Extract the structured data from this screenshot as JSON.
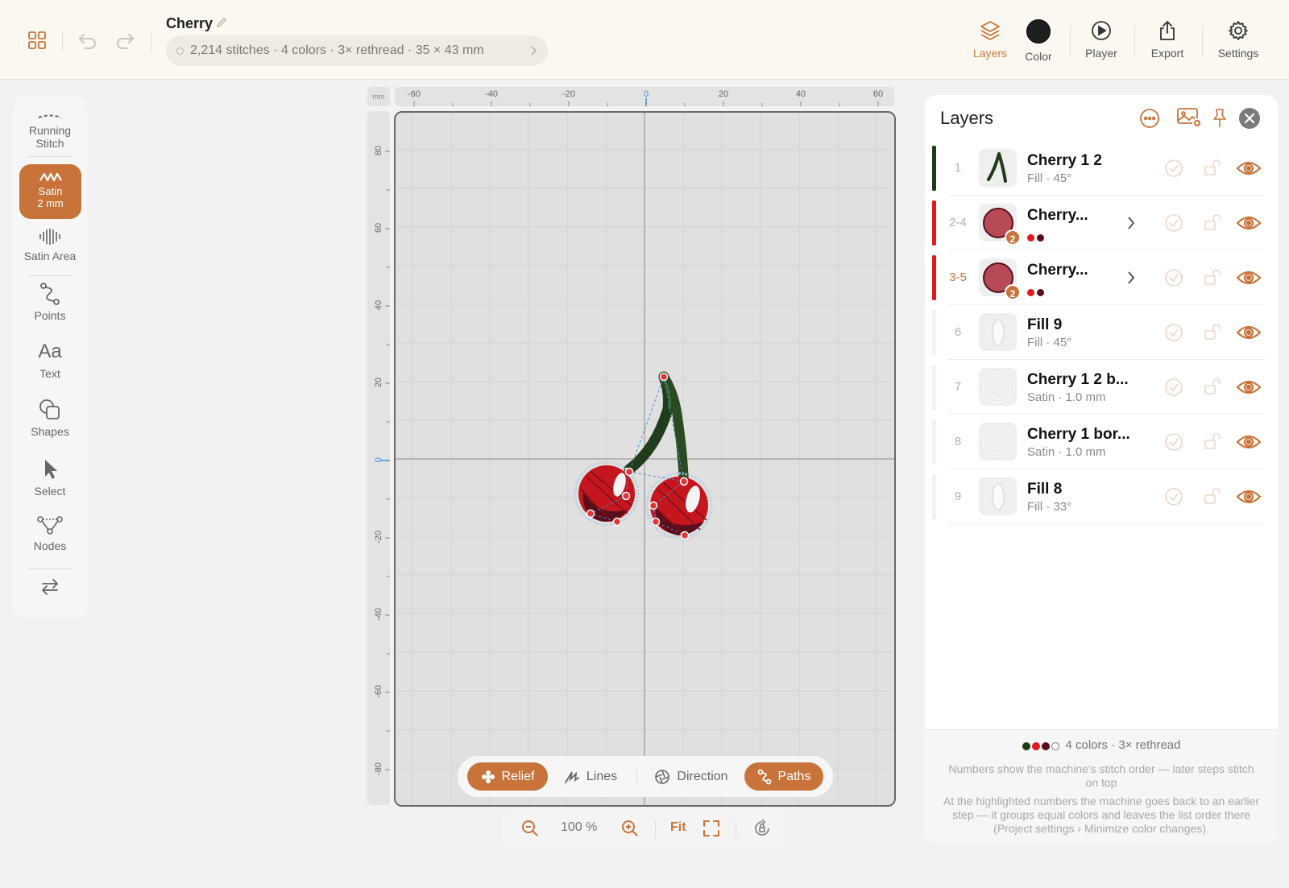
{
  "header": {
    "doc_title": "Cherry",
    "summary": "2,214 stitches · 4 colors · 3× rethread · 35 × 43 mm",
    "buttons": {
      "layers": "Layers",
      "color": "Color",
      "player": "Player",
      "export": "Export",
      "settings": "Settings"
    },
    "current_color": "#1f1f1f"
  },
  "left_tools": {
    "running_stitch": [
      "Running",
      "Stitch"
    ],
    "satin": [
      "Satin",
      "2 mm"
    ],
    "satin_area": "Satin Area",
    "points": "Points",
    "text": "Text",
    "text_glyph": "Aa",
    "shapes": "Shapes",
    "select": "Select",
    "nodes": "Nodes"
  },
  "ruler": {
    "unit": "mm",
    "top": [
      "-60",
      "-40",
      "-20",
      "0",
      "20",
      "40",
      "60"
    ],
    "left": [
      "80",
      "60",
      "40",
      "20",
      "0",
      "-20",
      "-40",
      "-60",
      "-80"
    ]
  },
  "view_modes": {
    "relief": "Relief",
    "lines": "Lines",
    "direction": "Direction",
    "paths": "Paths"
  },
  "zoom": {
    "level": "100 %",
    "fit": "Fit"
  },
  "layers_panel": {
    "title": "Layers",
    "rows": [
      {
        "num": "1",
        "name": "Cherry 1 2",
        "sub": "Fill · 45°",
        "bar_color": "#1e3b17",
        "has_chevron": false,
        "highlight": false
      },
      {
        "num": "2-4",
        "name": "Cherry...",
        "sub": "",
        "bar_color": "#e3181c",
        "has_chevron": true,
        "highlight": false,
        "badge": "2",
        "dots": [
          "#e3181c",
          "#5a0e1a"
        ]
      },
      {
        "num": "3-5",
        "name": "Cherry...",
        "sub": "",
        "bar_color": "#e3181c",
        "has_chevron": true,
        "highlight": true,
        "badge": "2",
        "dots": [
          "#e3181c",
          "#5a0e1a"
        ]
      },
      {
        "num": "6",
        "name": "Fill 9",
        "sub": "Fill · 45°",
        "bar_color": "#f2f0fb",
        "has_chevron": false,
        "highlight": false
      },
      {
        "num": "7",
        "name": "Cherry 1 2 b...",
        "sub": "Satin · 1.0 mm",
        "bar_color": "#f2f0fb",
        "has_chevron": false,
        "highlight": false
      },
      {
        "num": "8",
        "name": "Cherry 1 bor...",
        "sub": "Satin · 1.0 mm",
        "bar_color": "#f2f0fb",
        "has_chevron": false,
        "highlight": false
      },
      {
        "num": "9",
        "name": "Fill 8",
        "sub": "Fill · 33°",
        "bar_color": "#f2f0fb",
        "has_chevron": false,
        "highlight": false
      }
    ],
    "footer": {
      "summary": "4 colors · 3× rethread",
      "colors": [
        "#1e3b17",
        "#e3181c",
        "#5a0e1a",
        "#ffffff"
      ],
      "note1": "Numbers show the machine's stitch order — later steps stitch on top",
      "note2": "At the highlighted numbers the machine goes back to an earlier step — it groups equal colors and leaves the list order there (Project settings › Minimize color changes)."
    }
  }
}
